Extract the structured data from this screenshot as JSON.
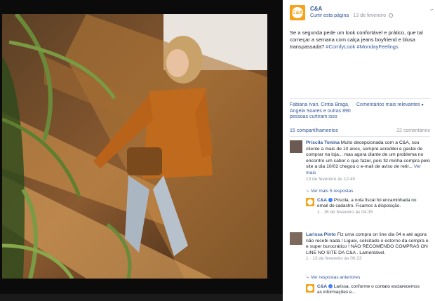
{
  "post": {
    "page_name": "C&A",
    "avatar_text": "C&A",
    "like_page": "Curtir esta página",
    "date": "13 de fevereiro",
    "caption": "Se a segunda pede um look confortável e prático, que tal começar a semana com calça jeans boyfriend e blusa transpassada?",
    "hashtag1": "#ComfyLook",
    "hashtag2": "#MondayFeelings"
  },
  "reactions": {
    "names": "Fabiana Ivan, Cintia Braga, Angela Soares e outras 890 pessoas curtiram isso",
    "relevant": "Comentários mais relevantes"
  },
  "counts": {
    "shares": "15 compartilhamentos",
    "comments": "22 comentários"
  },
  "comments": [
    {
      "author": "Priscila Tonina",
      "text": "Muito decepcionada com a C&A, sou cliente a mais de 10 anos, sempre acreditei e gastei de comprar na loja... mas agora diante de um problema no encontro um cabor o que fazer, pois fiz minha compra pelo site a dia 10/02 chegou o e-mail de aviso de retir...",
      "see_more": "Ver mais",
      "meta": "13 de fevereiro às 12:40",
      "view_replies": "Ver mais 5 respostas",
      "reply": {
        "author": "C&A",
        "text": "Priscila, a nota fiscal foi encaminhada no email do cadastro. Ficamos à disposição.",
        "meta": "1 · 16 de fevereiro às 04:35"
      }
    },
    {
      "author": "Larissa Pinto",
      "text": "Fiz uma compra on line dia 04 e até agora não recebi nada ! Liguei, solicitado o estorno da compra e e super burocrático ! NÃO RECOMENDO COMPRAS ON LINE NO SITE DA C&A . Lamentável.",
      "meta": "1 · 13 de fevereiro às 00:23",
      "view_replies": "Ver respostas anteriores",
      "reply": {
        "author": "C&A",
        "text": "Larissa, conforme o contato esclarecemos as informações e..."
      }
    }
  ],
  "colors": {
    "brand": "#f5a31a",
    "link": "#365899"
  }
}
